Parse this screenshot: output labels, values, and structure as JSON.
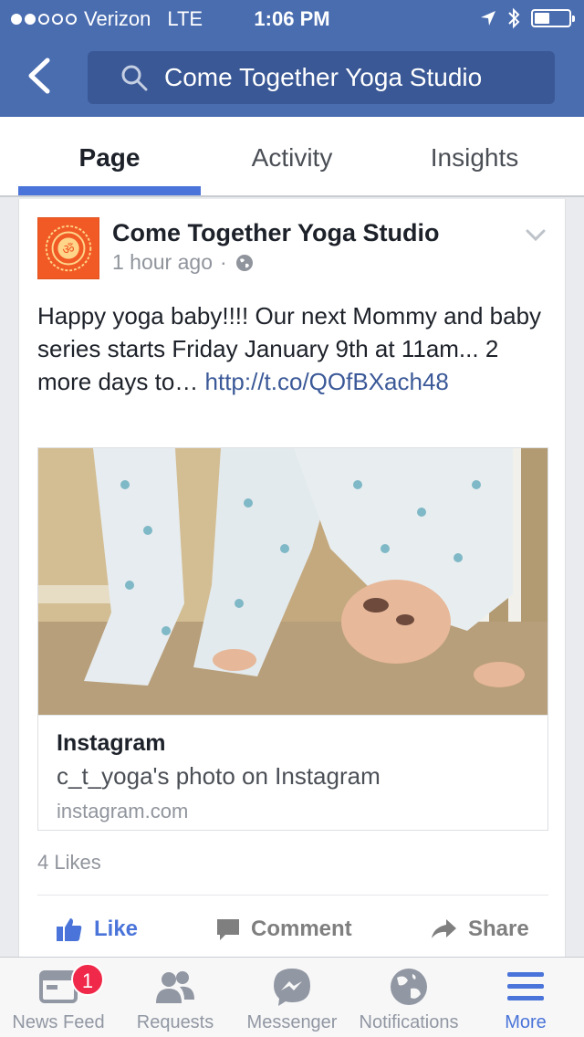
{
  "status_bar": {
    "carrier": "Verizon",
    "network": "LTE",
    "time": "1:06 PM",
    "signal_bars_filled": 2,
    "signal_bars_total": 5,
    "battery_level": 0.35
  },
  "nav": {
    "search_query": "Come Together Yoga Studio"
  },
  "tabs": [
    {
      "label": "Page",
      "active": true
    },
    {
      "label": "Activity",
      "active": false
    },
    {
      "label": "Insights",
      "active": false
    }
  ],
  "post": {
    "author": "Come Together Yoga Studio",
    "time": "1 hour ago",
    "separator": "·",
    "text": "Happy yoga baby!!!! Our next Mommy and baby series starts Friday January 9th at 11am... 2 more days to… ",
    "link": "http://t.co/QOfBXach48",
    "attachment": {
      "title": "Instagram",
      "description": "c_t_yoga's photo on Instagram",
      "domain": "instagram.com"
    },
    "likes": "4 Likes",
    "actions": {
      "like": "Like",
      "comment": "Comment",
      "share": "Share"
    }
  },
  "tab_bar": {
    "items": [
      {
        "label": "News Feed",
        "icon": "news-feed-icon",
        "badge": "1"
      },
      {
        "label": "Requests",
        "icon": "friend-requests-icon"
      },
      {
        "label": "Messenger",
        "icon": "messenger-icon"
      },
      {
        "label": "Notifications",
        "icon": "globe-icon"
      },
      {
        "label": "More",
        "icon": "menu-icon",
        "active": true
      }
    ]
  },
  "colors": {
    "header": "#4a6db0",
    "accent": "#4a74d9",
    "badge": "#f02849",
    "avatar": "#f15a24"
  }
}
